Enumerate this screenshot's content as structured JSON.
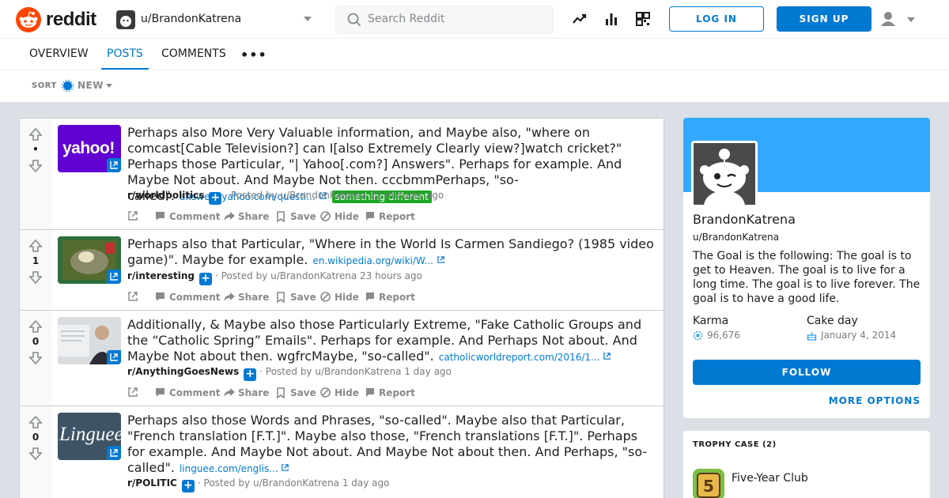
{
  "header": {
    "logo_text": "reddit",
    "user_name": "u/BrandonKatrena",
    "search_placeholder": "Search Reddit",
    "login_label": "LOG IN",
    "signup_label": "SIGN UP",
    "icons": [
      "popular-icon",
      "all-icon",
      "coins-icon",
      "user-icon"
    ]
  },
  "tabs": [
    {
      "label": "OVERVIEW"
    },
    {
      "label": "POSTS",
      "active": true
    },
    {
      "label": "COMMENTS"
    },
    {
      "label": "•••"
    }
  ],
  "sort": {
    "label": "SORT",
    "value": "NEW"
  },
  "posts": [
    {
      "score": "•",
      "thumb": "yahoo!",
      "title": "Perhaps also More Very Valuable information, and Maybe also, \"where on comcast[Cable Television?] can I[also Extremely Clearly view?]watch cricket?\" Perhaps those Particular, \"| Yahoo[.com?] Answers\". Perhaps for example. And Maybe Not about. And Maybe Not then. cccbmmPerhaps, \"so-called\".",
      "link": "answers.yahoo.com/questi...",
      "flair": "something different",
      "subreddit": "r/worldpolitics",
      "meta": "· Posted by u/BrandonKatrena 22 minutes ago"
    },
    {
      "score": "1",
      "thumb": "",
      "title": "Perhaps also that Particular, \"Where in the World Is Carmen Sandiego? (1985 video game)\". Maybe for example.",
      "link": "en.wikipedia.org/wiki/W...",
      "flair": "",
      "subreddit": "r/interesting",
      "meta": "· Posted by u/BrandonKatrena 23 hours ago"
    },
    {
      "score": "0",
      "thumb": "",
      "title": "Additionally, & Maybe also those Particularly Extreme, \"Fake Catholic Groups and the “Catholic Spring” Emails\". Perhaps for example. And Perhaps Not about. And Maybe Not about then. wgfrcMaybe, \"so-called\".",
      "link": "catholicworldreport.com/2016/1...",
      "flair": "",
      "subreddit": "r/AnythingGoesNews",
      "meta": "· Posted by u/BrandonKatrena 1 day ago"
    },
    {
      "score": "0",
      "thumb": "Linguee",
      "title": "Perhaps also those Words and Phrases, \"so-called\". Maybe also that Particular, \"French translation [F.T.]\". Maybe also those, \"French translations [F.T.]\". Perhaps for example. And Maybe Not about. And Maybe Not about then. And Perhaps, \"so-called\".",
      "link": "linguee.com/englis...",
      "flair": "",
      "subreddit": "r/POLITIC",
      "meta": "· Posted by u/BrandonKatrena 1 day ago"
    }
  ],
  "actions": {
    "comment": "Comment",
    "share": "Share",
    "save": "Save",
    "hide": "Hide",
    "report": "Report"
  },
  "profile": {
    "display_name": "BrandonKatrena",
    "username": "u/BrandonKatrena",
    "bio": "The Goal is the following: The goal is to get to Heaven. The goal is to live for a long time. The goal is to live forever. The goal is to have a good life.",
    "karma_label": "Karma",
    "karma_value": "96,676",
    "cakeday_label": "Cake day",
    "cakeday_value": "January 4, 2014",
    "follow_label": "FOLLOW",
    "more_options_label": "MORE OPTIONS"
  },
  "trophy_case": {
    "heading": "TROPHY CASE (2)",
    "first_trophy": "Five-Year Club"
  },
  "colors": {
    "brand": "#ff4500",
    "accent": "#0079d3",
    "flair": "#1aa822",
    "banner": "#33a8ff"
  }
}
